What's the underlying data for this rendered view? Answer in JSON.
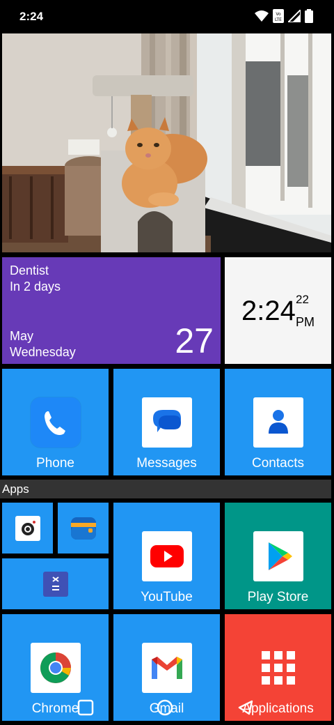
{
  "status_bar": {
    "time": "2:24",
    "icons": [
      "wifi-icon",
      "volte-icon",
      "signal-icon",
      "battery-icon"
    ]
  },
  "calendar": {
    "event_title": "Dentist",
    "event_when": "In 2 days",
    "month": "May",
    "weekday": "Wednesday",
    "day": "27"
  },
  "clock": {
    "time": "2:24",
    "seconds": "22",
    "ampm": "PM"
  },
  "tiles": {
    "phone": "Phone",
    "messages": "Messages",
    "contacts": "Contacts",
    "youtube": "YouTube",
    "play_store": "Play Store",
    "chrome": "Chrome",
    "gmail": "Gmail",
    "applications": "Applications"
  },
  "apps_section": {
    "label": "Apps"
  },
  "colors": {
    "tile_blue": "#2196f3",
    "calendar_purple": "#673ab7",
    "play_store_teal": "#009688",
    "applications_red": "#f44336"
  }
}
